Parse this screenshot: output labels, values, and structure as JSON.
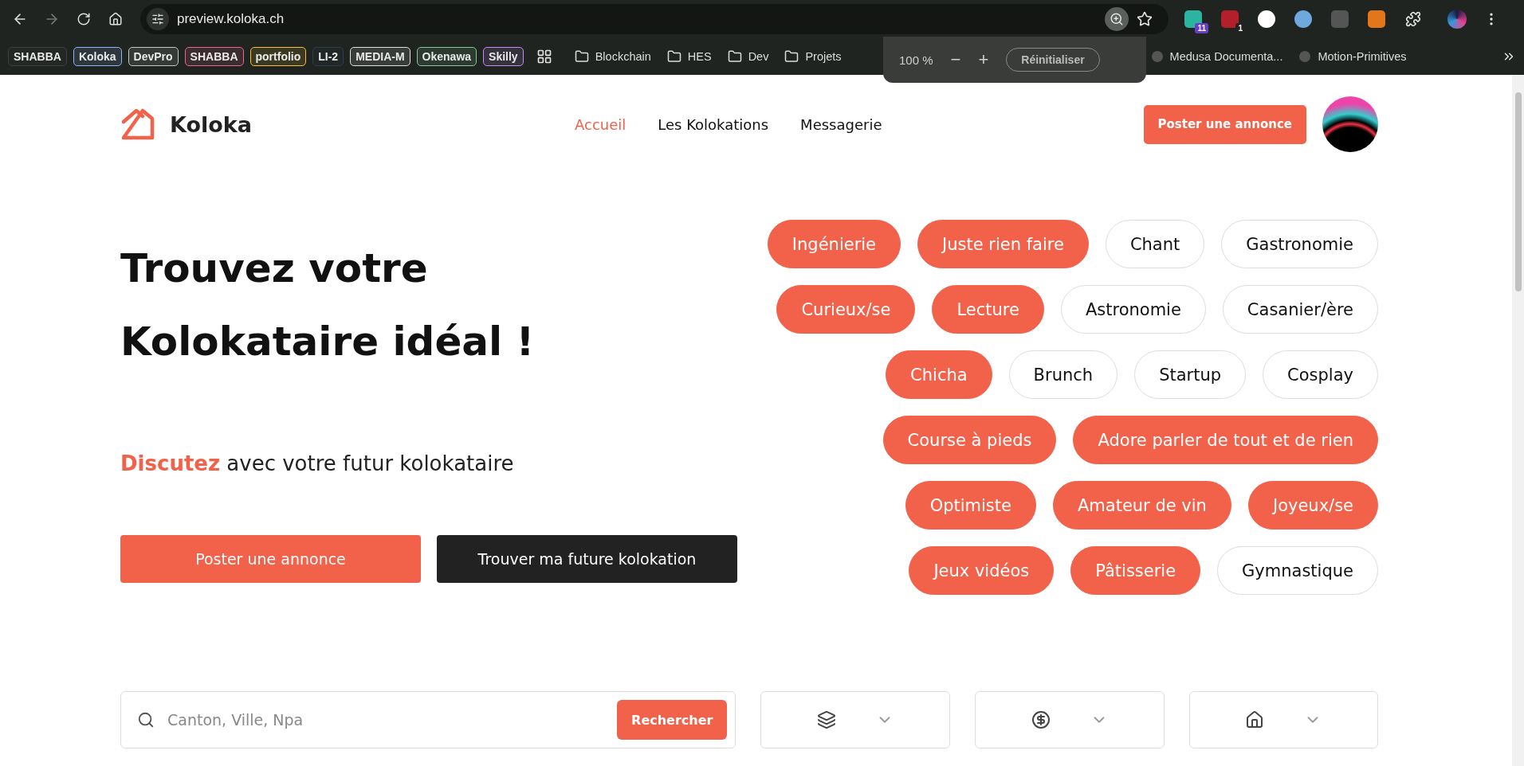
{
  "browser": {
    "url": "preview.koloka.ch",
    "bookmarks": [
      {
        "label": "SHABBA",
        "kind": "chip",
        "color": "#3c4043"
      },
      {
        "label": "Koloka",
        "kind": "chip",
        "color": "#8ab4f8"
      },
      {
        "label": "DevPro",
        "kind": "chip",
        "color": "#c4c7c5"
      },
      {
        "label": "SHABBA",
        "kind": "chip",
        "color": "#f06292"
      },
      {
        "label": "portfolio",
        "kind": "chip",
        "color": "#fbc02d"
      },
      {
        "label": "LI-2",
        "kind": "chip",
        "color": "#2c3e50"
      },
      {
        "label": "MEDIA-M",
        "kind": "chip",
        "color": "#e0e0e0"
      },
      {
        "label": "Okenawa",
        "kind": "chip",
        "color": "#81c995"
      },
      {
        "label": "Skilly",
        "kind": "chip",
        "color": "#c58af9"
      },
      {
        "label": "Blockchain",
        "kind": "folder"
      },
      {
        "label": "HES",
        "kind": "folder"
      },
      {
        "label": "Dev",
        "kind": "folder"
      },
      {
        "label": "Projets",
        "kind": "folder"
      },
      {
        "label": "Medusa Documenta...",
        "kind": "site"
      },
      {
        "label": "Motion-Primitives",
        "kind": "site"
      }
    ],
    "extension_badges": [
      "11",
      "1"
    ],
    "zoom_popup": {
      "level": "100 %",
      "minus": "−",
      "plus": "+",
      "reset": "Réinitialiser"
    }
  },
  "header": {
    "brand": "Koloka",
    "nav": [
      {
        "label": "Accueil",
        "selected": true
      },
      {
        "label": "Les Kolokations",
        "selected": false
      },
      {
        "label": "Messagerie",
        "selected": false
      }
    ],
    "cta": "Poster une annonce"
  },
  "hero": {
    "title_lines": [
      "Trouvez votre",
      "Kolokataire idéal !"
    ],
    "highlight": "Discutez",
    "subtitle": " avec votre futur kolokataire",
    "buttons": [
      {
        "label": "Poster une annonce",
        "kind": "primary"
      },
      {
        "label": "Trouver ma future kolokation",
        "kind": "dark"
      }
    ]
  },
  "tag_rows": [
    [
      {
        "label": "Ingénierie",
        "selected": true
      },
      {
        "label": "Juste rien faire",
        "selected": true
      },
      {
        "label": "Chant",
        "selected": false
      },
      {
        "label": "Gastronomie",
        "selected": false
      }
    ],
    [
      {
        "label": "Curieux/se",
        "selected": true
      },
      {
        "label": "Lecture",
        "selected": true
      },
      {
        "label": "Astronomie",
        "selected": false
      },
      {
        "label": "Casanier/ère",
        "selected": false
      }
    ],
    [
      {
        "label": "Chicha",
        "selected": true
      },
      {
        "label": "Brunch",
        "selected": false
      },
      {
        "label": "Startup",
        "selected": false
      },
      {
        "label": "Cosplay",
        "selected": false
      }
    ],
    [
      {
        "label": "Course à pieds",
        "selected": true
      },
      {
        "label": "Adore parler de tout et de rien",
        "selected": true
      }
    ],
    [
      {
        "label": "Optimiste",
        "selected": true
      },
      {
        "label": "Amateur de vin",
        "selected": true
      },
      {
        "label": "Joyeux/se",
        "selected": true
      }
    ],
    [
      {
        "label": "Jeux vidéos",
        "selected": true
      },
      {
        "label": "Pâtisserie",
        "selected": true
      },
      {
        "label": "Gymnastique",
        "selected": false
      }
    ]
  ],
  "search": {
    "placeholder": "Canton, Ville, Npa",
    "button": "Rechercher"
  },
  "filters": [
    {
      "kind": "rooms"
    },
    {
      "kind": "price"
    },
    {
      "kind": "home"
    }
  ]
}
